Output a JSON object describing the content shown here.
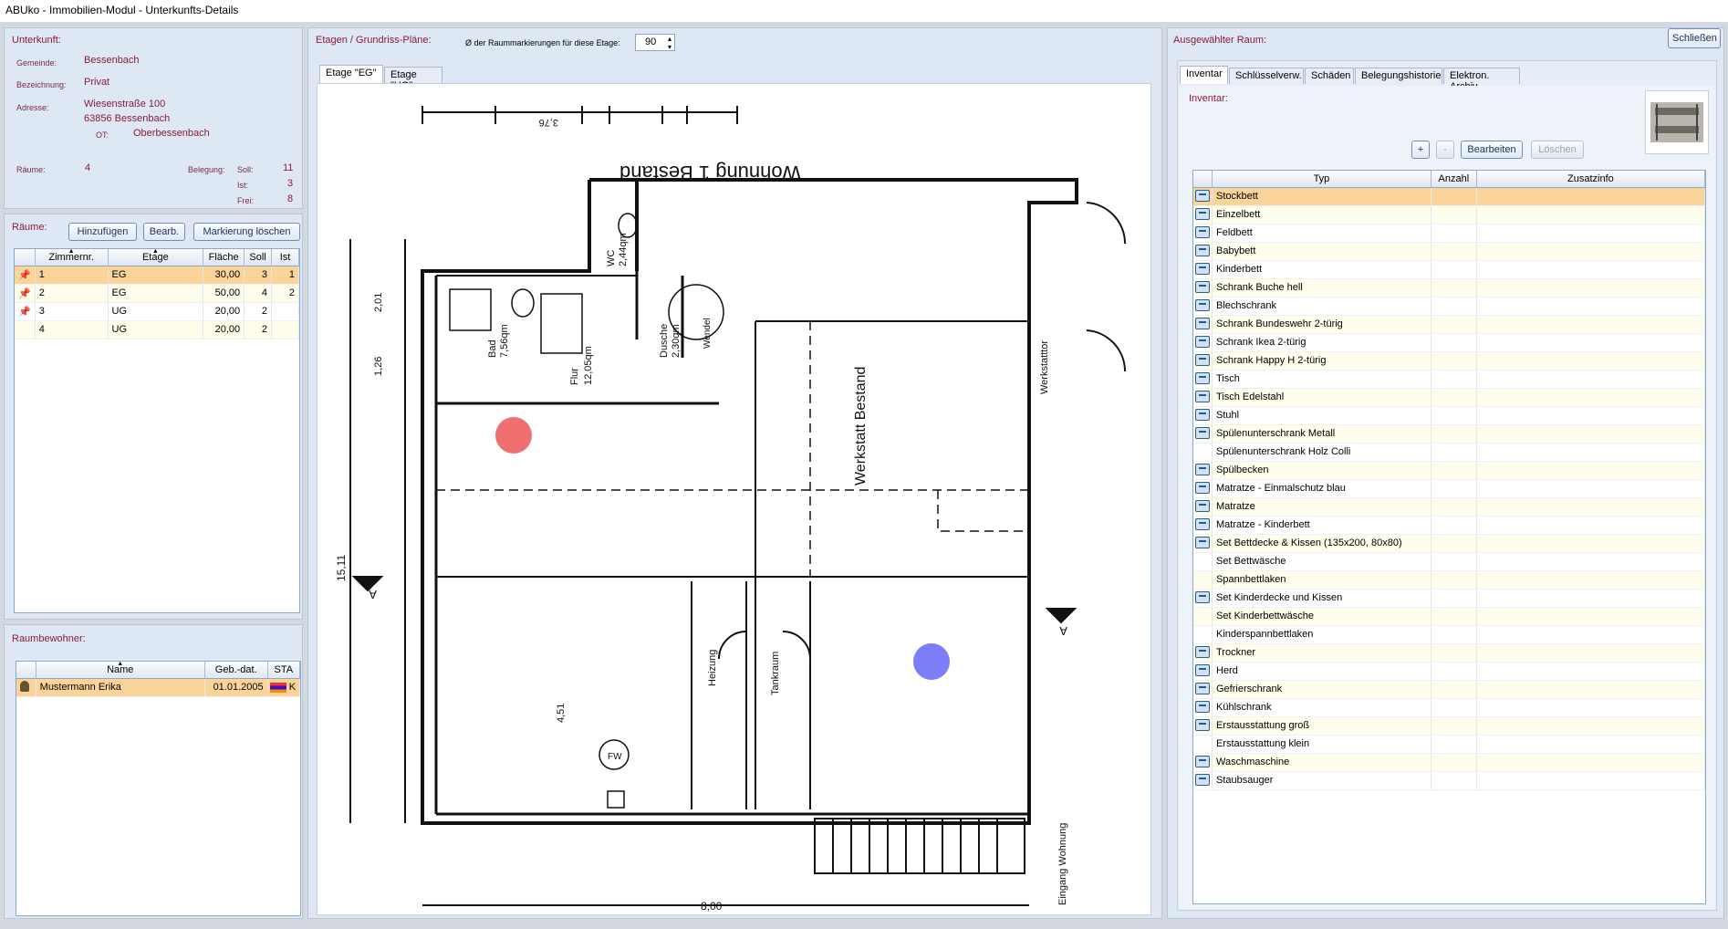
{
  "window": {
    "title": "ABUko  -  Immobilien-Modul  -  Unterkunfts-Details"
  },
  "unterkunft": {
    "header": "Unterkunft:",
    "gemeinde_label": "Gemeinde:",
    "gemeinde": "Bessenbach",
    "bezeichnung_label": "Bezeichnung:",
    "bezeichnung": "Privat",
    "adresse_label": "Adresse:",
    "strasse": "Wiesenstraße 100",
    "plz_ort": "63856  Bessenbach",
    "ot_label": "OT:",
    "ot": "Oberbessenbach",
    "raeume_label": "Räume:",
    "raeume": "4",
    "belegung_label": "Belegung:",
    "soll_label": "Soll:",
    "soll": "11",
    "ist_label": "Ist:",
    "ist": "3",
    "frei_label": "Frei:",
    "frei": "8"
  },
  "raeume": {
    "header": "Räume:",
    "add_button": "Hinzufügen",
    "edit_button": "Bearb.",
    "clear_marker_button": "Markierung löschen",
    "columns": [
      "Zimmernr.",
      "Etage",
      "Fläche",
      "Soll",
      "Ist"
    ],
    "rows": [
      {
        "nr": "1",
        "etage": "EG",
        "flaeche": "30,00",
        "soll": "3",
        "ist": "1",
        "pinned": true
      },
      {
        "nr": "2",
        "etage": "EG",
        "flaeche": "50,00",
        "soll": "4",
        "ist": "2",
        "pinned": true
      },
      {
        "nr": "3",
        "etage": "UG",
        "flaeche": "20,00",
        "soll": "2",
        "ist": "",
        "pinned": true
      },
      {
        "nr": "4",
        "etage": "UG",
        "flaeche": "20,00",
        "soll": "2",
        "ist": "",
        "pinned": false
      }
    ]
  },
  "bewohner": {
    "header": "Raumbewohner:",
    "columns": [
      "Name",
      "Geb.-dat.",
      "STA"
    ],
    "rows": [
      {
        "name": "Mustermann Erika",
        "geb": "01.01.2005",
        "sta": "K"
      }
    ]
  },
  "plans": {
    "header": "Etagen / Grundriss-Pläne:",
    "marker_label": "Ø der Raummarkierungen für diese Etage:",
    "marker_value": "90",
    "tabs": [
      "Etage \"EG\"",
      "Etage \"UG\""
    ],
    "active_tab": 0,
    "plan_texts": {
      "title": "Wohnung 1 Bestand",
      "werkstatt": "Werkstatt Bestand",
      "wc": "WC",
      "wc_area": "2,44qm",
      "bad": "Bad",
      "bad_area": "7,56qm",
      "dusche": "Dusche",
      "dusche_area": "2,30qm",
      "flur": "Flur",
      "flur_area": "12,05qm",
      "wendel": "Wendel",
      "heizung": "Heizung",
      "tankraum": "Tankraum",
      "fw": "FW",
      "werkstatttor": "Werkstatttor",
      "eingang": "Eingang Wohnung",
      "dim_total": "8,00",
      "dim_height": "15,11",
      "dim_451": "4,51",
      "dim_201": "2,01",
      "dim_126": "1,26",
      "dim_376": "3,76",
      "section_mark": "A"
    },
    "markers": [
      {
        "color": "#f07070"
      },
      {
        "color": "#7b7ef6"
      }
    ]
  },
  "selected_room": {
    "header": "Ausgewählter Raum:",
    "close_button": "Schließen",
    "tabs": [
      "Inventar",
      "Schlüsselverw.",
      "Schäden",
      "Belegungshistorie",
      "Elektron. Archiv"
    ],
    "inventar_label": "Inventar:",
    "plus_button": "+",
    "minus_button": "-",
    "edit_button": "Bearbeiten",
    "delete_button": "Löschen",
    "columns": [
      "Typ",
      "Anzahl",
      "Zusatzinfo"
    ],
    "items": [
      {
        "typ": "Stockbett",
        "icon": true
      },
      {
        "typ": "Einzelbett",
        "icon": true
      },
      {
        "typ": "Feldbett",
        "icon": true
      },
      {
        "typ": "Babybett",
        "icon": true
      },
      {
        "typ": "Kinderbett",
        "icon": true
      },
      {
        "typ": "Schrank Buche hell",
        "icon": true
      },
      {
        "typ": "Blechschrank",
        "icon": true
      },
      {
        "typ": "Schrank Bundeswehr 2-türig",
        "icon": true
      },
      {
        "typ": "Schrank Ikea 2-türig",
        "icon": true
      },
      {
        "typ": "Schrank Happy H 2-türig",
        "icon": true
      },
      {
        "typ": "Tisch",
        "icon": true
      },
      {
        "typ": "Tisch Edelstahl",
        "icon": true
      },
      {
        "typ": "Stuhl",
        "icon": true
      },
      {
        "typ": "Spülenunterschrank Metall",
        "icon": true
      },
      {
        "typ": "Spülenunterschrank Holz Colli",
        "icon": false
      },
      {
        "typ": "Spülbecken",
        "icon": true
      },
      {
        "typ": "Matratze - Einmalschutz blau",
        "icon": true
      },
      {
        "typ": "Matratze",
        "icon": true
      },
      {
        "typ": "Matratze - Kinderbett",
        "icon": true
      },
      {
        "typ": "Set Bettdecke & Kissen (135x200, 80x80)",
        "icon": true
      },
      {
        "typ": "Set Bettwäsche",
        "icon": false
      },
      {
        "typ": "Spannbettlaken",
        "icon": false
      },
      {
        "typ": "Set Kinderdecke und Kissen",
        "icon": true
      },
      {
        "typ": "Set Kinderbettwäsche",
        "icon": false
      },
      {
        "typ": "Kinderspannbettlaken",
        "icon": false
      },
      {
        "typ": "Trockner",
        "icon": true
      },
      {
        "typ": "Herd",
        "icon": true
      },
      {
        "typ": "Gefrierschrank",
        "icon": true
      },
      {
        "typ": "Kühlschrank",
        "icon": true
      },
      {
        "typ": "Erstausstattung groß",
        "icon": true
      },
      {
        "typ": "Erstausstattung klein",
        "icon": false
      },
      {
        "typ": "Waschmaschine",
        "icon": true
      },
      {
        "typ": "Staubsauger",
        "icon": true
      }
    ]
  }
}
